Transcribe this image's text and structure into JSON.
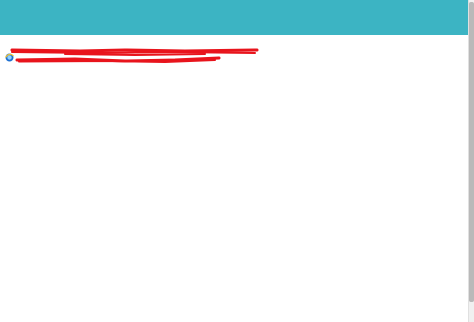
{
  "header": {
    "background_color": "#3cb4c3"
  },
  "content": {
    "link_item": {
      "icon": "internet-explorer-icon",
      "text": "",
      "redaction_color": "#e8141c"
    }
  },
  "scrollbar": {
    "track_color": "#f0f0f0",
    "thumb_color": "#b9b9b9"
  }
}
